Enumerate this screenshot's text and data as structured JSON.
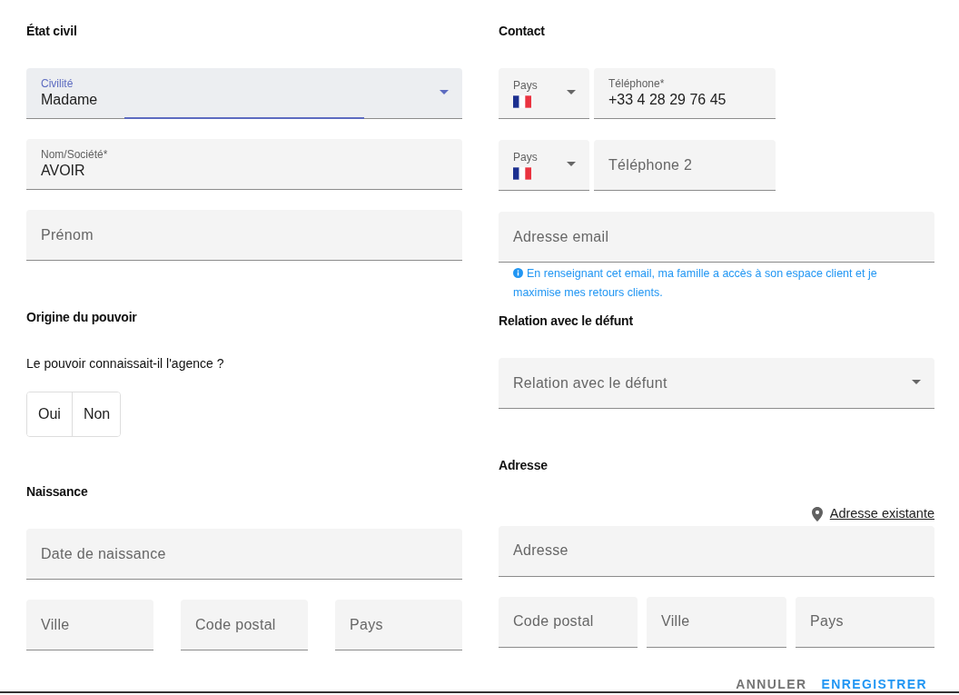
{
  "etat_civil": {
    "title": "État civil",
    "fields": [
      {
        "kind": "select",
        "label": "Civilité",
        "value": "Madame",
        "focused": true
      },
      {
        "kind": "text",
        "label": "Nom/Société*",
        "value": "AVOIR",
        "focused": false
      },
      {
        "kind": "text",
        "placeholder": "Prénom",
        "focused": false
      }
    ]
  },
  "origine_du_pouvoir": {
    "title": "Origine du pouvoir",
    "question": "Le pouvoir connaissait-il l'agence ?",
    "options": [
      {
        "label": "Oui",
        "selected": false
      },
      {
        "label": "Non",
        "selected": false
      }
    ]
  },
  "naissance": {
    "title": "Naissance",
    "date": {
      "placeholder": "Date de naissance"
    },
    "place_fields": [
      {
        "placeholder": "Ville"
      },
      {
        "placeholder": "Code postal"
      },
      {
        "placeholder": "Pays"
      }
    ]
  },
  "contact": {
    "title": "Contact",
    "phones": [
      {
        "country": {
          "kind": "flag",
          "label": "Pays"
        },
        "number": {
          "label": "Téléphone*",
          "value": "+33 4 28 29 76 45"
        }
      },
      {
        "country": {
          "kind": "flag",
          "label": "Pays"
        },
        "number": {
          "placeholder": "Téléphone 2"
        }
      }
    ],
    "email": {
      "placeholder": "Adresse email"
    },
    "email_hint": "En renseignant cet email, ma famille a accès à son espace client et je maximise mes retours clients."
  },
  "relation": {
    "title": "Relation avec le défunt",
    "field": {
      "kind": "select",
      "placeholder": "Relation avec le défunt"
    }
  },
  "adresse": {
    "title": "Adresse",
    "existing_link": "Adresse existante",
    "address": {
      "placeholder": "Adresse"
    },
    "place_fields": [
      {
        "placeholder": "Code postal"
      },
      {
        "placeholder": "Ville"
      },
      {
        "placeholder": "Pays"
      }
    ]
  },
  "actions": [
    {
      "label": "ANNULER",
      "kind": "secondary"
    },
    {
      "label": "ENREGISTRER",
      "kind": "primary"
    }
  ]
}
